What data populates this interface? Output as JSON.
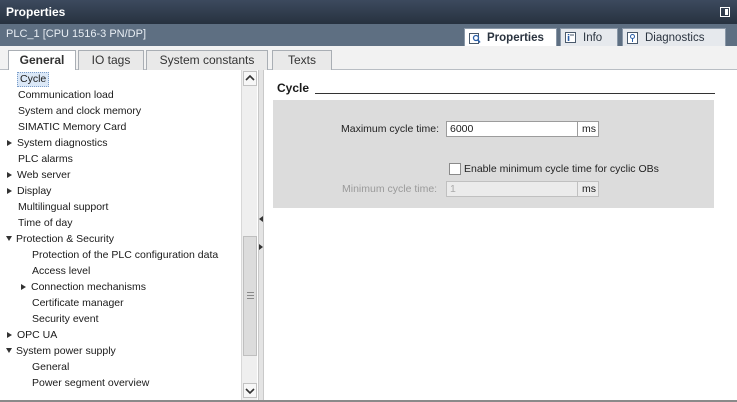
{
  "window": {
    "title": "Properties"
  },
  "device": {
    "name": "PLC_1 [CPU 1516-3 PN/DP]"
  },
  "inspector_tabs": [
    {
      "label": "Properties",
      "icon": "properties-icon"
    },
    {
      "label": "Info",
      "icon": "info-icon"
    },
    {
      "label": "Diagnostics",
      "icon": "diagnostics-icon"
    }
  ],
  "tabs": [
    {
      "label": "General"
    },
    {
      "label": "IO tags"
    },
    {
      "label": "System constants"
    },
    {
      "label": "Texts"
    }
  ],
  "nav": [
    {
      "label": "Cycle",
      "expander": "none",
      "selected": true
    },
    {
      "label": "Communication load",
      "expander": "none"
    },
    {
      "label": "System and clock memory",
      "expander": "none"
    },
    {
      "label": "SIMATIC Memory Card",
      "expander": "none"
    },
    {
      "label": "System diagnostics",
      "expander": "collapsed"
    },
    {
      "label": "PLC alarms",
      "expander": "none"
    },
    {
      "label": "Web server",
      "expander": "collapsed"
    },
    {
      "label": "Display",
      "expander": "collapsed"
    },
    {
      "label": "Multilingual support",
      "expander": "none"
    },
    {
      "label": "Time of day",
      "expander": "none"
    },
    {
      "label": "Protection & Security",
      "expander": "expanded"
    },
    {
      "label": "Protection of the PLC configuration data",
      "expander": "none",
      "child": true
    },
    {
      "label": "Access level",
      "expander": "none",
      "child": true
    },
    {
      "label": "Connection mechanisms",
      "expander": "collapsed",
      "child": true
    },
    {
      "label": "Certificate manager",
      "expander": "none",
      "child": true
    },
    {
      "label": "Security event",
      "expander": "none",
      "child": true
    },
    {
      "label": "OPC UA",
      "expander": "collapsed"
    },
    {
      "label": "System power supply",
      "expander": "expanded"
    },
    {
      "label": "General",
      "expander": "none",
      "child": true
    },
    {
      "label": "Power segment overview",
      "expander": "none",
      "child": true
    }
  ],
  "content": {
    "section_title": "Cycle",
    "max_cycle_label": "Maximum cycle time:",
    "max_cycle_value": "6000",
    "max_cycle_unit": "ms",
    "enable_min_label": "Enable minimum cycle time for cyclic OBs",
    "enable_min_checked": false,
    "min_cycle_label": "Minimum cycle time:",
    "min_cycle_value": "1",
    "min_cycle_unit": "ms"
  }
}
